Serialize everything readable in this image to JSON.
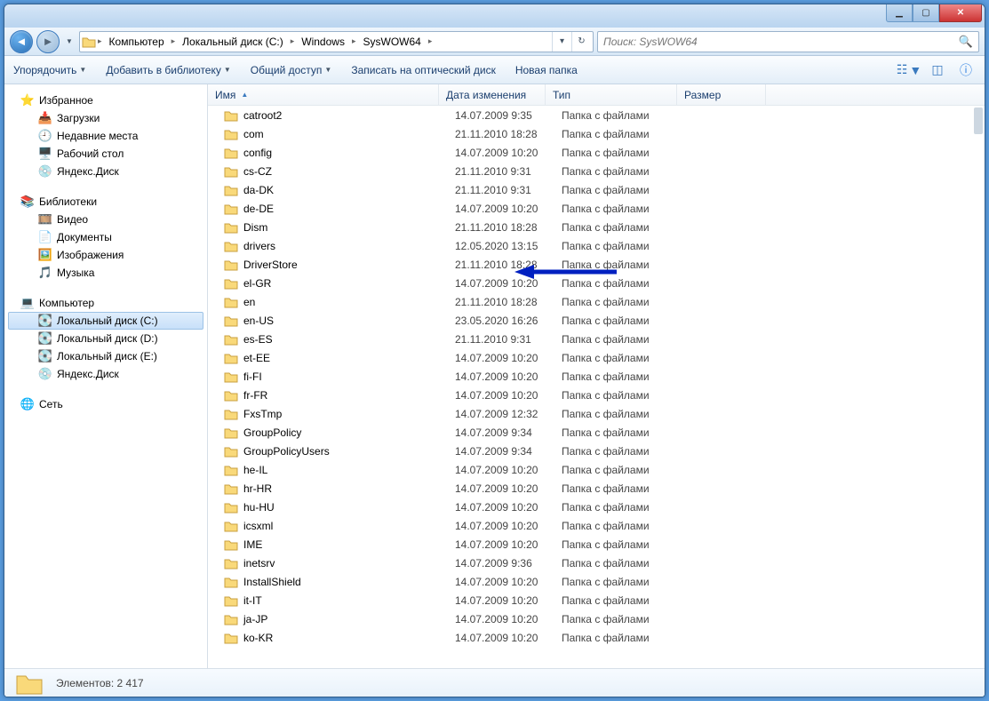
{
  "search": {
    "placeholder": "Поиск: SysWOW64"
  },
  "breadcrumb": [
    "Компьютер",
    "Локальный диск (C:)",
    "Windows",
    "SysWOW64"
  ],
  "toolbar": {
    "organize": "Упорядочить",
    "addlib": "Добавить в библиотеку",
    "share": "Общий доступ",
    "burn": "Записать на оптический диск",
    "newfolder": "Новая папка"
  },
  "tree": {
    "favorites": "Избранное",
    "downloads": "Загрузки",
    "recent": "Недавние места",
    "desktop": "Рабочий стол",
    "yadisk": "Яндекс.Диск",
    "libraries": "Библиотеки",
    "video": "Видео",
    "docs": "Документы",
    "pics": "Изображения",
    "music": "Музыка",
    "computer": "Компьютер",
    "driveC": "Локальный диск (C:)",
    "driveD": "Локальный диск (D:)",
    "driveE": "Локальный диск (E:)",
    "yadisk2": "Яндекс.Диск",
    "network": "Сеть"
  },
  "cols": {
    "name": "Имя",
    "date": "Дата изменения",
    "type": "Тип",
    "size": "Размер"
  },
  "type_folder": "Папка с файлами",
  "files": [
    {
      "n": "catroot2",
      "d": "14.07.2009 9:35"
    },
    {
      "n": "com",
      "d": "21.11.2010 18:28"
    },
    {
      "n": "config",
      "d": "14.07.2009 10:20"
    },
    {
      "n": "cs-CZ",
      "d": "21.11.2010 9:31"
    },
    {
      "n": "da-DK",
      "d": "21.11.2010 9:31"
    },
    {
      "n": "de-DE",
      "d": "14.07.2009 10:20"
    },
    {
      "n": "Dism",
      "d": "21.11.2010 18:28"
    },
    {
      "n": "drivers",
      "d": "12.05.2020 13:15"
    },
    {
      "n": "DriverStore",
      "d": "21.11.2010 18:28"
    },
    {
      "n": "el-GR",
      "d": "14.07.2009 10:20"
    },
    {
      "n": "en",
      "d": "21.11.2010 18:28"
    },
    {
      "n": "en-US",
      "d": "23.05.2020 16:26"
    },
    {
      "n": "es-ES",
      "d": "21.11.2010 9:31"
    },
    {
      "n": "et-EE",
      "d": "14.07.2009 10:20"
    },
    {
      "n": "fi-FI",
      "d": "14.07.2009 10:20"
    },
    {
      "n": "fr-FR",
      "d": "14.07.2009 10:20"
    },
    {
      "n": "FxsTmp",
      "d": "14.07.2009 12:32"
    },
    {
      "n": "GroupPolicy",
      "d": "14.07.2009 9:34"
    },
    {
      "n": "GroupPolicyUsers",
      "d": "14.07.2009 9:34"
    },
    {
      "n": "he-IL",
      "d": "14.07.2009 10:20"
    },
    {
      "n": "hr-HR",
      "d": "14.07.2009 10:20"
    },
    {
      "n": "hu-HU",
      "d": "14.07.2009 10:20"
    },
    {
      "n": "icsxml",
      "d": "14.07.2009 10:20"
    },
    {
      "n": "IME",
      "d": "14.07.2009 10:20"
    },
    {
      "n": "inetsrv",
      "d": "14.07.2009 9:36"
    },
    {
      "n": "InstallShield",
      "d": "14.07.2009 10:20"
    },
    {
      "n": "it-IT",
      "d": "14.07.2009 10:20"
    },
    {
      "n": "ja-JP",
      "d": "14.07.2009 10:20"
    },
    {
      "n": "ko-KR",
      "d": "14.07.2009 10:20"
    }
  ],
  "status": {
    "items": "Элементов: 2 417"
  }
}
